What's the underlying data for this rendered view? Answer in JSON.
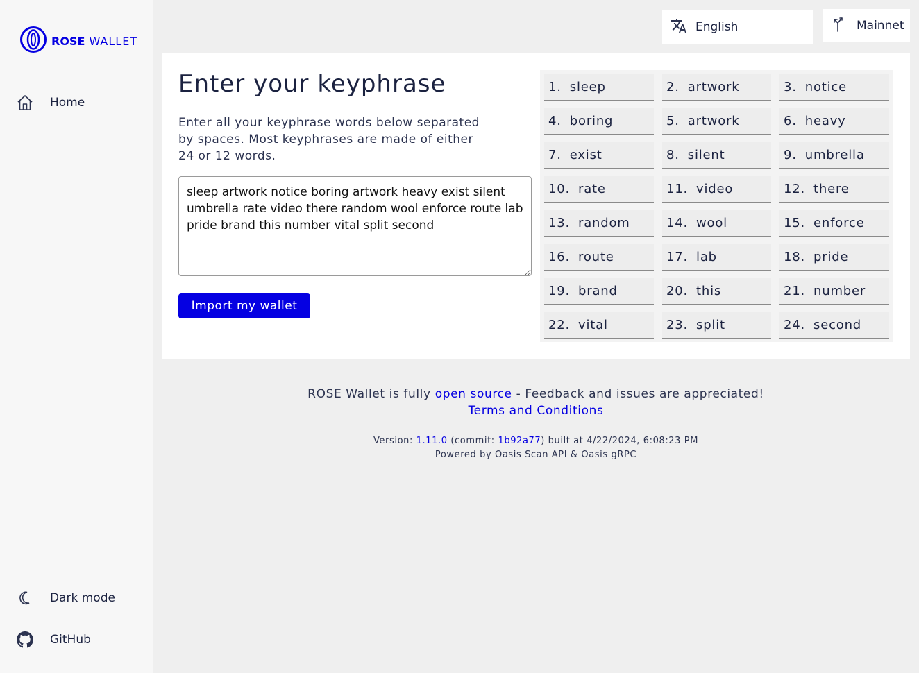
{
  "brand": {
    "name_bold": "ROSE",
    "name_rest": "WALLET"
  },
  "sidebar": {
    "home": "Home",
    "dark_mode": "Dark mode",
    "github": "GitHub"
  },
  "header": {
    "language": "English",
    "network": "Mainnet"
  },
  "main": {
    "title": "Enter your keyphrase",
    "description": "Enter all your keyphrase words below separated by spaces. Most keyphrases are made of either 24 or 12 words.",
    "textarea_value": "sleep artwork notice boring artwork heavy exist silent umbrella rate video there random wool enforce route lab pride brand this number vital split second",
    "import_button": "Import my wallet",
    "words": [
      {
        "n": "1.",
        "w": "sleep"
      },
      {
        "n": "2.",
        "w": "artwork"
      },
      {
        "n": "3.",
        "w": "notice"
      },
      {
        "n": "4.",
        "w": "boring"
      },
      {
        "n": "5.",
        "w": "artwork"
      },
      {
        "n": "6.",
        "w": "heavy"
      },
      {
        "n": "7.",
        "w": "exist"
      },
      {
        "n": "8.",
        "w": "silent"
      },
      {
        "n": "9.",
        "w": "umbrella"
      },
      {
        "n": "10.",
        "w": "rate"
      },
      {
        "n": "11.",
        "w": "video"
      },
      {
        "n": "12.",
        "w": "there"
      },
      {
        "n": "13.",
        "w": "random"
      },
      {
        "n": "14.",
        "w": "wool"
      },
      {
        "n": "15.",
        "w": "enforce"
      },
      {
        "n": "16.",
        "w": "route"
      },
      {
        "n": "17.",
        "w": "lab"
      },
      {
        "n": "18.",
        "w": "pride"
      },
      {
        "n": "19.",
        "w": "brand"
      },
      {
        "n": "20.",
        "w": "this"
      },
      {
        "n": "21.",
        "w": "number"
      },
      {
        "n": "22.",
        "w": "vital"
      },
      {
        "n": "23.",
        "w": "split"
      },
      {
        "n": "24.",
        "w": "second"
      }
    ]
  },
  "footer": {
    "line1_prefix": "ROSE Wallet is fully",
    "open_source_link": "open source",
    "line1_suffix": "- Feedback and issues are appreciated!",
    "terms_link": "Terms and Conditions",
    "version_label": "Version:",
    "version_link": "1.11.0",
    "commit_prefix": "(commit:",
    "commit_link": "1b92a77",
    "built_text": ") built at 4/22/2024, 6:08:23 PM",
    "powered_by": "Powered by Oasis Scan API & Oasis gRPC"
  },
  "colors": {
    "accent": "#0500e2",
    "sidebar_bg": "#f7f7f7",
    "page_bg": "#efefef"
  }
}
